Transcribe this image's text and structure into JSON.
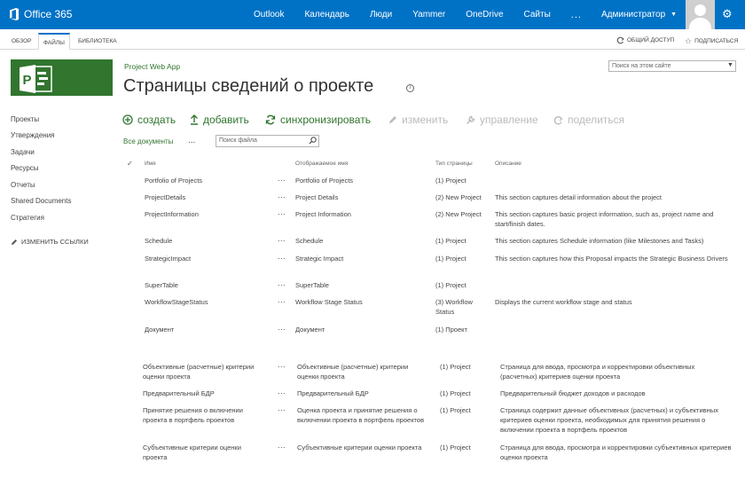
{
  "suite": {
    "brand": "Office 365",
    "nav": [
      "Outlook",
      "Календарь",
      "Люди",
      "Yammer",
      "OneDrive",
      "Сайты"
    ],
    "more": "...",
    "user": "Администратор",
    "caret": "▼",
    "gear": "⚙",
    "accent": "#0072c6"
  },
  "ribbon": {
    "tabs": [
      "ОБЗОР",
      "ФАЙЛЫ",
      "БИБЛИОТЕКА"
    ],
    "share": "ОБЩИЙ ДОСТУП",
    "follow": "ПОДПИСАТЬСЯ"
  },
  "site": {
    "name": "Project Web App",
    "title": "Страницы сведений о проекте",
    "search_placeholder": "Поиск на этом сайте",
    "logo_color": "#31752f"
  },
  "leftnav": {
    "items": [
      "Проекты",
      "Утверждения",
      "Задачи",
      "Ресурсы",
      "Отчеты",
      "Shared Documents",
      "Стратегия"
    ],
    "edit_links": "ИЗМЕНИТЬ ССЫЛКИ"
  },
  "commands": [
    {
      "label": "создать",
      "icon": "plus-circle-icon",
      "enabled": true
    },
    {
      "label": "добавить",
      "icon": "upload-icon",
      "enabled": true
    },
    {
      "label": "синхронизировать",
      "icon": "sync-icon",
      "enabled": true
    },
    {
      "label": "изменить",
      "icon": "pencil-icon",
      "enabled": false
    },
    {
      "label": "управление",
      "icon": "wrench-icon",
      "enabled": false
    },
    {
      "label": "поделиться",
      "icon": "share-icon",
      "enabled": false
    }
  ],
  "views": {
    "current": "Все документы",
    "more": "...",
    "search_placeholder": "Поиск файла"
  },
  "table": {
    "check": "✓",
    "headers": [
      "Имя",
      "Отображаемое имя",
      "Тип страницы",
      "Описание"
    ],
    "rows": [
      {
        "name": "Portfolio of Projects",
        "display": "Portfolio of Projects",
        "type": "(1) Project",
        "desc": ""
      },
      {
        "name": "ProjectDetails",
        "display": "Project Details",
        "type": "(2) New Project",
        "desc": "This section captures detail information about the project"
      },
      {
        "name": "ProjectInformation",
        "display": "Project Information",
        "type": "(2) New Project",
        "desc": "This section captures basic project information, such as, project name and start/finish dates."
      },
      {
        "name": "Schedule",
        "display": "Schedule",
        "type": "(1) Project",
        "desc": "This section captures Schedule information (like Milestones and Tasks)"
      },
      {
        "name": "StrategicImpact",
        "display": "Strategic Impact",
        "type": "(1) Project",
        "desc": "This section captures how this Proposal impacts the Strategic Business Drivers"
      },
      {
        "name": "SuperTable",
        "display": "SuperTable",
        "type": "(1) Project",
        "desc": ""
      },
      {
        "name": "WorkflowStageStatus",
        "display": "Workflow Stage Status",
        "type": "(3) Workflow Status",
        "desc": "Displays the current workflow stage and status"
      },
      {
        "name": "Документ",
        "display": "Документ",
        "type": "(1) Проект",
        "desc": ""
      }
    ],
    "rows2": [
      {
        "name": "Объективные (расчетные) критерии оценки проекта",
        "display": "Объективные (расчетные) критерии оценки проекта",
        "type": "(1) Project",
        "desc": "Страница для ввода, просмотра  и корректировки объективных (расчетных) критериев оценки проекта"
      },
      {
        "name": "Предварительный БДР",
        "display": "Предварительный БДР",
        "type": "(1) Project",
        "desc": "Предварительный бюджет доходов и расходов"
      },
      {
        "name": "Принятие решения о включении проекта в портфель проектов",
        "display": "Оценка проекта и принятие решения о включении проекта в портфель проектов",
        "type": "(1) Project",
        "desc": "Страница содержит данные объективных (расчетных) и субъективных критериев оценки проекта, необходимых для принятия решения о включении проекта в портфель проектов"
      },
      {
        "name": "Субъективные критерии оценки проекта",
        "display": "Субъективные критерии оценки проекта",
        "type": "(1) Project",
        "desc": "Страница для ввода, просмотра  и корректировки субъективных критериев оценки проекта"
      }
    ],
    "row_more": "..."
  }
}
